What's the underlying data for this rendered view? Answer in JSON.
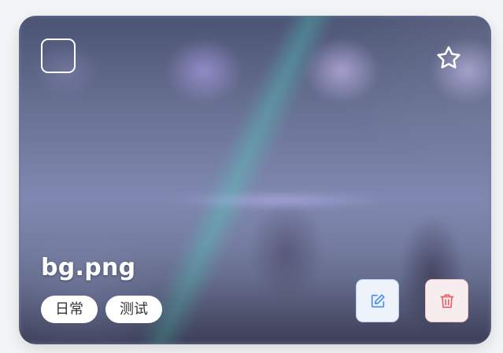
{
  "card": {
    "filename": "bg.png",
    "tags": [
      "日常",
      "测试"
    ],
    "selected": false,
    "favorited": false
  },
  "icons": {
    "checkbox": "checkbox-icon",
    "favorite": "star-icon",
    "edit": "edit-icon",
    "delete": "trash-icon"
  },
  "colors": {
    "edit_accent": "#4a8cf0",
    "delete_accent": "#ee5f6e",
    "tag_background": "#ffffff",
    "tag_text": "#333333"
  }
}
